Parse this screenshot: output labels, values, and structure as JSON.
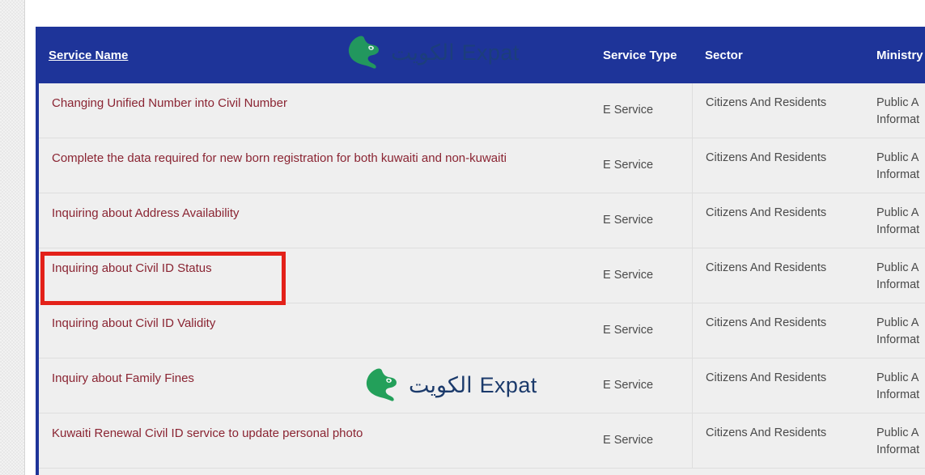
{
  "table": {
    "headers": [
      {
        "label": "Service Name",
        "name": "service-name",
        "sortable": true
      },
      {
        "label": "Service Type",
        "name": "service-type",
        "sortable": false
      },
      {
        "label": "Sector",
        "name": "sector",
        "sortable": false
      },
      {
        "label": "Ministry",
        "name": "ministry",
        "sortable": false
      }
    ],
    "rows": [
      {
        "service_name": "Changing Unified Number into Civil Number",
        "service_type": "E Service",
        "sector": "Citizens And Residents",
        "ministry": "Public A\nInformat"
      },
      {
        "service_name": "Complete the data required for new born registration for both kuwaiti and non-kuwaiti",
        "service_type": "E Service",
        "sector": "Citizens And Residents",
        "ministry": "Public A\nInformat"
      },
      {
        "service_name": "Inquiring about Address Availability",
        "service_type": "E Service",
        "sector": "Citizens And Residents",
        "ministry": "Public A\nInformat"
      },
      {
        "service_name": "Inquiring about Civil ID Status",
        "service_type": "E Service",
        "sector": "Citizens And Residents",
        "ministry": "Public A\nInformat"
      },
      {
        "service_name": "Inquiring about Civil ID Validity",
        "service_type": "E Service",
        "sector": "Citizens And Residents",
        "ministry": "Public A\nInformat"
      },
      {
        "service_name": "Inquiry about Family Fines",
        "service_type": "E Service",
        "sector": "Citizens And Residents",
        "ministry": "Public A\nInformat"
      },
      {
        "service_name": "Kuwaiti Renewal Civil ID service to update personal photo",
        "service_type": "E Service",
        "sector": "Citizens And Residents",
        "ministry": "Public A\nInformat"
      }
    ]
  },
  "watermark": {
    "arabic": "الكويت",
    "english": "Expat",
    "map_icon": "kuwait-map-icon"
  },
  "annotation": {
    "kind": "red-highlight-rectangle",
    "target_row_service_name": "Inquiring about Civil ID Status",
    "color": "#e32119"
  },
  "colors": {
    "header_blue": "#1e3499",
    "link_maroon": "#8a2432",
    "row_background": "#efefef",
    "row_divider": "#dedede",
    "highlight_red": "#e32119",
    "watermark_green": "#23a05a",
    "watermark_navy": "#1b3a6b"
  }
}
